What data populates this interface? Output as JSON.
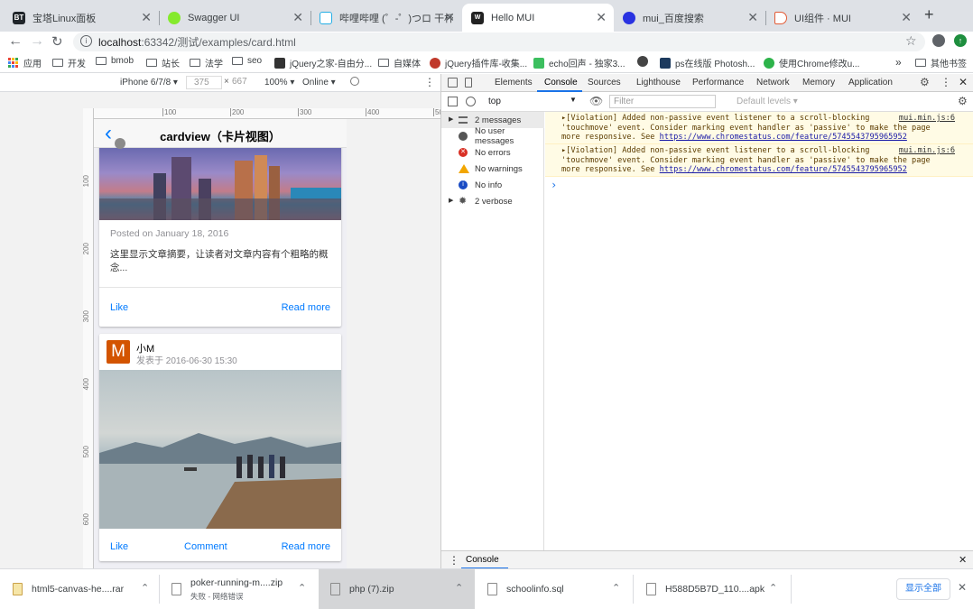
{
  "tabs": [
    {
      "label": "宝塔Linux面板",
      "fav": "BT",
      "color": "#20252a"
    },
    {
      "label": "Swagger UI",
      "fav": "",
      "color": "#85ea2d"
    },
    {
      "label": "哔哩哔哩 (゜-゜)つロ 干杯~-b",
      "fav": "",
      "color": "#23ade5"
    },
    {
      "label": "Hello MUI",
      "fav": "",
      "color": "#222"
    },
    {
      "label": "mui_百度搜索",
      "fav": "",
      "color": "#2932e1"
    },
    {
      "label": "UI组件 · MUI",
      "fav": "",
      "color": "#e25a35"
    }
  ],
  "new_tab": "+",
  "address": {
    "host": "localhost",
    "path": ":63342/测试/examples/card.html"
  },
  "bookmarks": [
    {
      "label": "应用",
      "type": "apps"
    },
    {
      "label": "开发",
      "type": "folder"
    },
    {
      "label": "bmob",
      "type": "folder"
    },
    {
      "label": "站长",
      "type": "folder"
    },
    {
      "label": "法学",
      "type": "folder"
    },
    {
      "label": "seo",
      "type": "folder"
    },
    {
      "label": "jQuery之家-自由分...",
      "type": "site",
      "color": "#333"
    },
    {
      "label": "自媒体",
      "type": "folder"
    },
    {
      "label": "jQuery插件库-收集...",
      "type": "site",
      "color": "#c0392b"
    },
    {
      "label": "echo回声 - 独家3...",
      "type": "site",
      "color": "#3cbf5f"
    },
    {
      "label": "",
      "type": "site",
      "color": "#444"
    },
    {
      "label": "ps在线版 Photosh...",
      "type": "site",
      "color": "#1c3a5e"
    },
    {
      "label": "使用Chrome修改u...",
      "type": "site",
      "color": "#2db34a"
    }
  ],
  "bookmarks_more": "»",
  "other_bookmarks": "其他书签",
  "device": {
    "name": "iPhone 6/7/8 ▾",
    "width": "375",
    "height": "667",
    "zoom": "100% ▾",
    "network": "Online ▾"
  },
  "ruler": {
    "h": [
      "100",
      "200",
      "300",
      "400",
      "50"
    ],
    "v": [
      "100",
      "200",
      "300",
      "400",
      "500",
      "600"
    ]
  },
  "page": {
    "title": "cardview（卡片视图）",
    "back": "‹",
    "card1": {
      "date": "Posted on January 18, 2016",
      "summary": "这里显示文章摘要，让读者对文章内容有个粗略的概念...",
      "like": "Like",
      "read_more": "Read more"
    },
    "card2": {
      "avatar": "M",
      "author": "小M",
      "posted": "发表于 2016-06-30 15:30",
      "like": "Like",
      "comment": "Comment",
      "read_more": "Read more"
    }
  },
  "devtools": {
    "tabs": [
      "Elements",
      "Console",
      "Sources",
      "Lighthouse",
      "Performance",
      "Network",
      "Memory",
      "Application"
    ],
    "context": "top",
    "filter_placeholder": "Filter",
    "levels": "Default levels ▾",
    "sidebar": [
      {
        "label": "2 messages",
        "icon": "list"
      },
      {
        "label": "No user messages",
        "icon": "user"
      },
      {
        "label": "No errors",
        "icon": "error"
      },
      {
        "label": "No warnings",
        "icon": "warning"
      },
      {
        "label": "No info",
        "icon": "info"
      },
      {
        "label": "2 verbose",
        "icon": "verbose"
      }
    ],
    "messages": [
      {
        "l1": "▸[Violation] Added non-passive event listener to a scroll-blocking",
        "src": "mui.min.js:6",
        "l2": "'touchmove' event. Consider marking event handler as 'passive' to make the page",
        "l3": "more responsive. See ",
        "url": "https://www.chromestatus.com/feature/5745543795965952"
      },
      {
        "l1": "▸[Violation] Added non-passive event listener to a scroll-blocking",
        "src": "mui.min.js:6",
        "l2": "'touchmove' event. Consider marking event handler as 'passive' to make the page",
        "l3": "more responsive. See ",
        "url": "https://www.chromestatus.com/feature/5745543795965952"
      }
    ],
    "prompt": "›",
    "drawer_tab": "Console"
  },
  "downloads": [
    {
      "name": "html5-canvas-he....rar",
      "status": ""
    },
    {
      "name": "poker-running-m....zip",
      "status": "失败 - 网络错误"
    },
    {
      "name": "php (7).zip",
      "status": ""
    },
    {
      "name": "schoolinfo.sql",
      "status": ""
    },
    {
      "name": "H588D5B7D_110....apk",
      "status": ""
    }
  ],
  "show_all": "显示全部",
  "colors": {
    "accent": "#007aff",
    "warn_bg": "#fffbe5"
  }
}
